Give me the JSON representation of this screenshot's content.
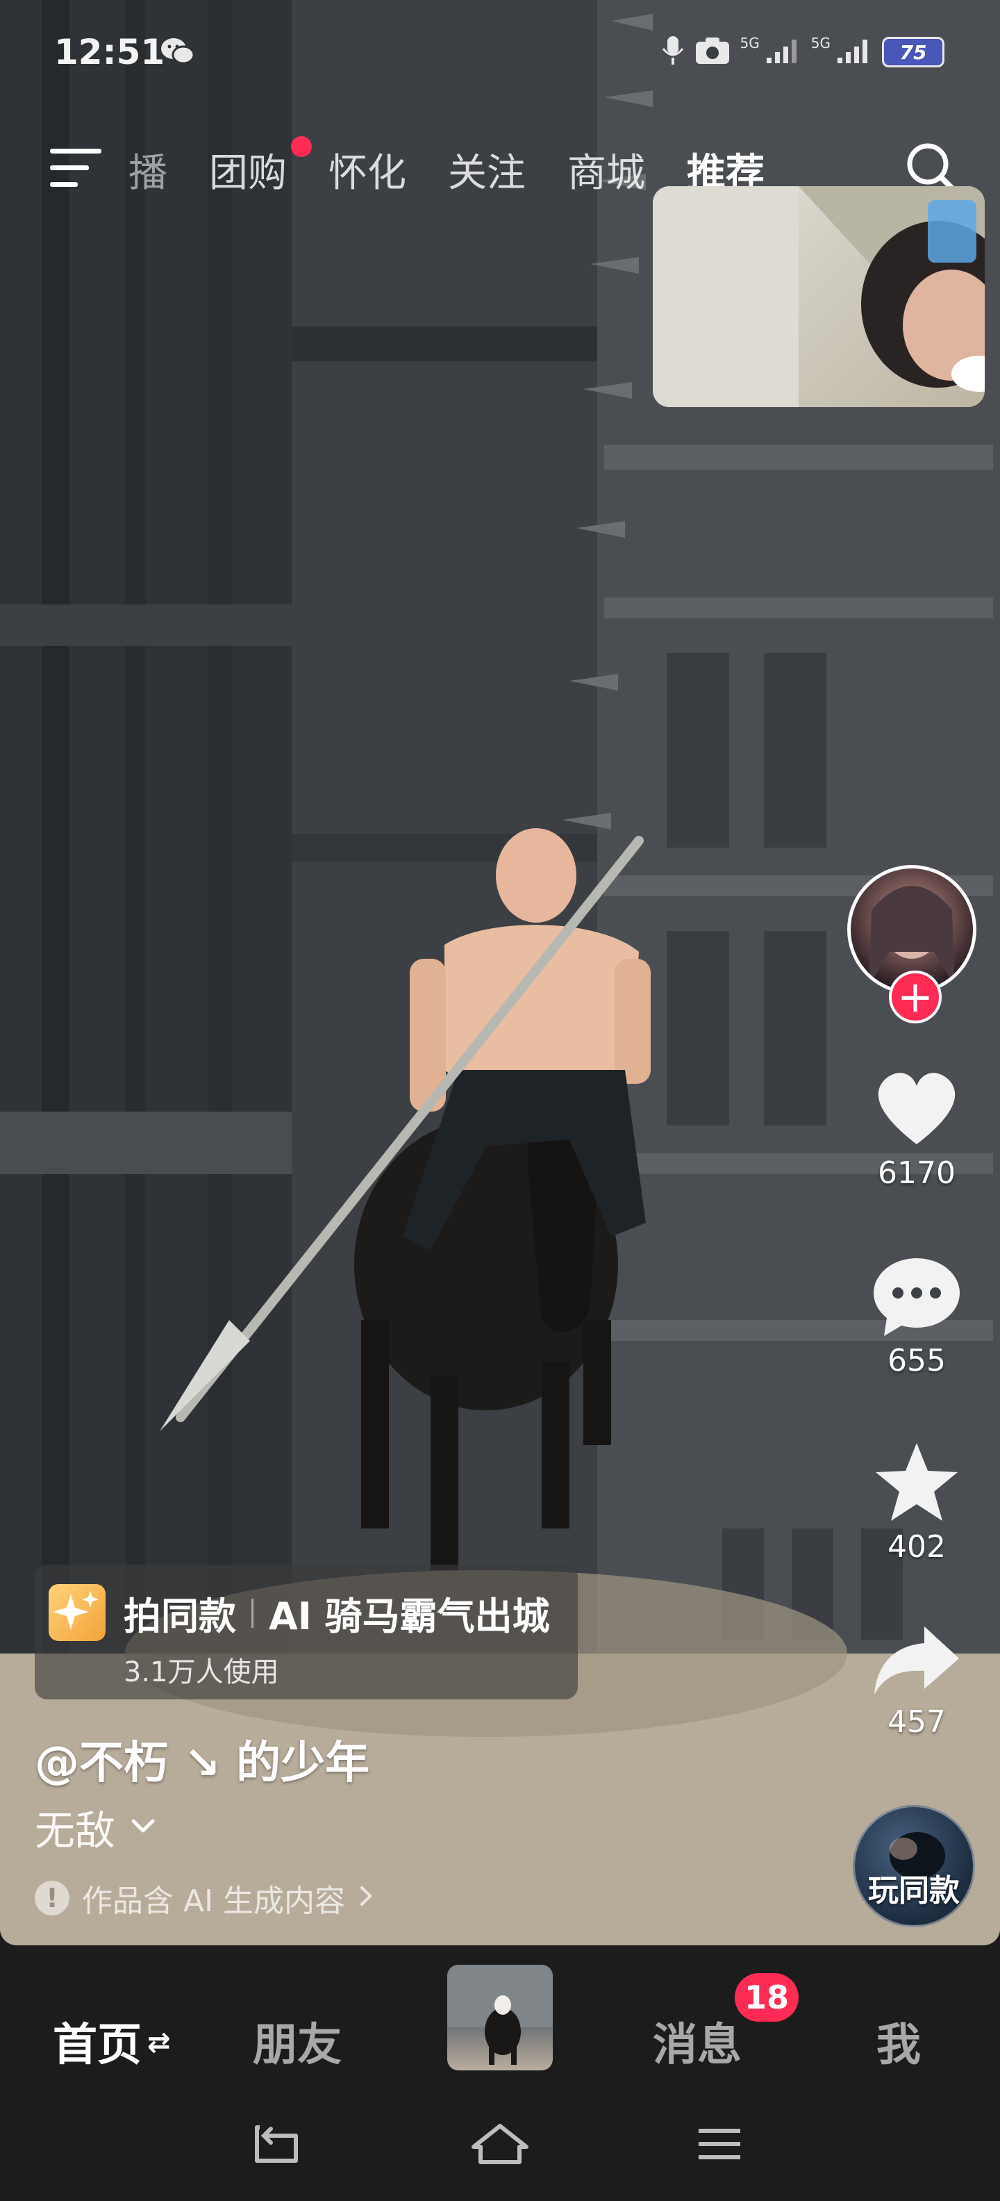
{
  "status_bar": {
    "time": "12:51",
    "network_label_1": "5G",
    "network_label_2": "5G",
    "battery": "75"
  },
  "top_nav": {
    "tabs": [
      {
        "label": "直播",
        "state": "partial"
      },
      {
        "label": "团购",
        "state": "normal",
        "has_dot": true
      },
      {
        "label": "怀化",
        "state": "normal"
      },
      {
        "label": "关注",
        "state": "normal"
      },
      {
        "label": "商城",
        "state": "normal"
      },
      {
        "label": "推荐",
        "state": "active"
      }
    ],
    "partial_tab_visible_text": "播"
  },
  "actions": {
    "likes": "6170",
    "comments": "655",
    "favorites": "402",
    "shares": "457"
  },
  "effect": {
    "action_label": "拍同款",
    "effect_name": "AI 骑马霸气出城",
    "usage": "3.1万人使用"
  },
  "post": {
    "author": "@不朽 ↘ 的少年",
    "caption": "无敌",
    "ai_notice": "作品含 AI 生成内容",
    "play_same_label": "玩同款"
  },
  "bottom_nav": {
    "home": "首页",
    "friends": "朋友",
    "messages": "消息",
    "messages_badge": "18",
    "me": "我"
  },
  "colors": {
    "accent_red": "#fe2c55",
    "bar_background": "#1c1c1c"
  },
  "icons": [
    "wechat-icon",
    "mic-icon",
    "camera-icon",
    "signal-icon",
    "battery-icon",
    "menu-icon",
    "search-icon",
    "heart-icon",
    "comment-icon",
    "star-icon",
    "share-icon",
    "chevron-down-icon",
    "info-icon",
    "back-icon",
    "home-icon",
    "recents-icon"
  ]
}
